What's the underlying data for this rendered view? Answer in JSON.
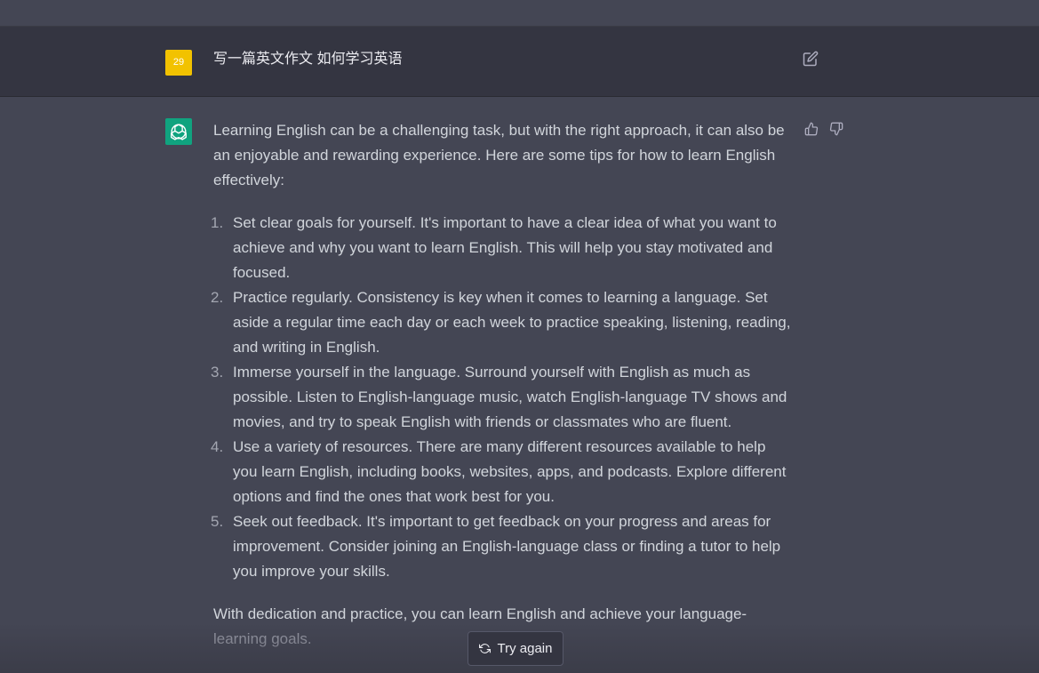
{
  "user_message": {
    "avatar_text": "29",
    "text": "写一篇英文作文 如何学习英语"
  },
  "assistant_message": {
    "intro": "Learning English can be a challenging task, but with the right approach, it can also be an enjoyable and rewarding experience. Here are some tips for how to learn English effectively:",
    "tips": [
      {
        "num": "1.",
        "text": "Set clear goals for yourself. It's important to have a clear idea of what you want to achieve and why you want to learn English. This will help you stay motivated and focused."
      },
      {
        "num": "2.",
        "text": "Practice regularly. Consistency is key when it comes to learning a language. Set aside a regular time each day or each week to practice speaking, listening, reading, and writing in English."
      },
      {
        "num": "3.",
        "text": "Immerse yourself in the language. Surround yourself with English as much as possible. Listen to English-language music, watch English-language TV shows and movies, and try to speak English with friends or classmates who are fluent."
      },
      {
        "num": "4.",
        "text": "Use a variety of resources. There are many different resources available to help you learn English, including books, websites, apps, and podcasts. Explore different options and find the ones that work best for you."
      },
      {
        "num": "5.",
        "text": "Seek out feedback. It's important to get feedback on your progress and areas for improvement. Consider joining an English-language class or finding a tutor to help you improve your skills."
      }
    ],
    "outro_part1": "With dedication and practice, you can learn English and achieve your language-",
    "outro_part2": "learning goals."
  },
  "actions": {
    "try_again_label": "Try again"
  },
  "colors": {
    "user_avatar": "#f2c200",
    "assistant_avatar": "#10a37f",
    "user_row_bg": "#343541",
    "assistant_row_bg": "#444654"
  },
  "icons": {
    "edit": "edit-icon",
    "thumbs_up": "thumbs-up-icon",
    "thumbs_down": "thumbs-down-icon",
    "regenerate": "refresh-icon",
    "assistant_logo": "openai-logo-icon"
  }
}
